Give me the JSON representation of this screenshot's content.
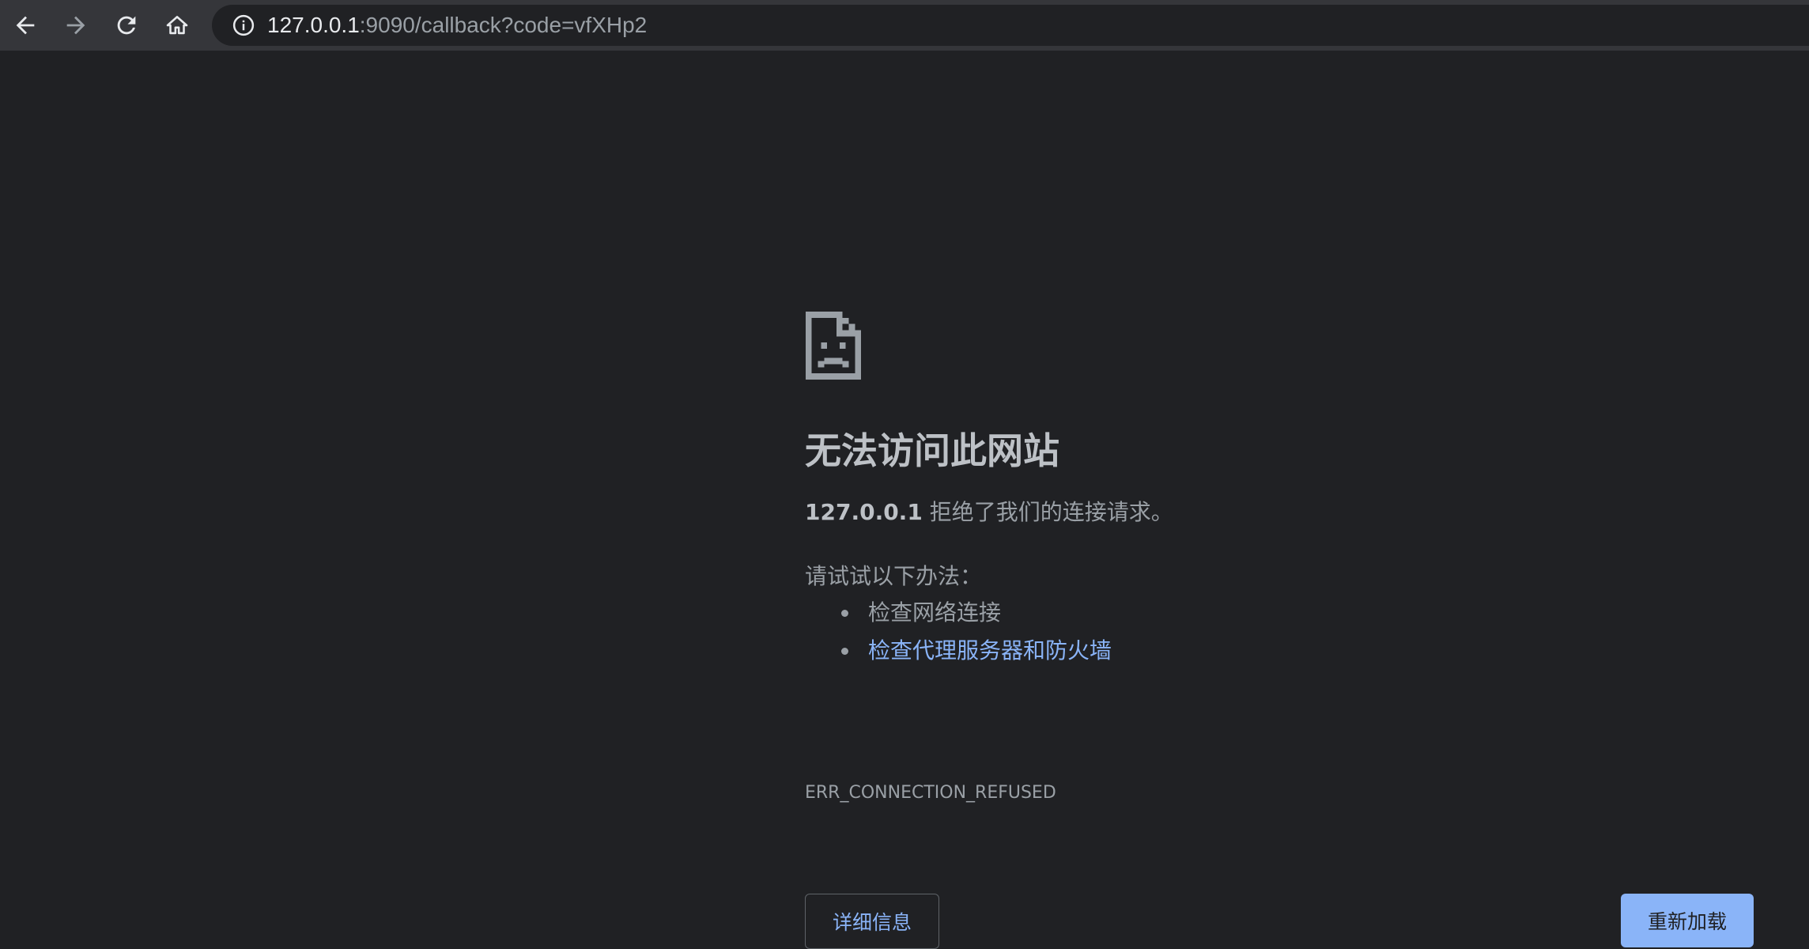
{
  "toolbar": {
    "icons": {
      "back": "arrow-left-icon",
      "forward": "arrow-right-icon",
      "reload": "reload-icon",
      "home": "home-icon",
      "site_info": "info-icon"
    },
    "url_host": "127.0.0.1",
    "url_rest": ":9090/callback?code=vfXHp2"
  },
  "error": {
    "icon": "sad-document-icon",
    "title": "无法访问此网站",
    "host": "127.0.0.1",
    "summary_rest": " 拒绝了我们的连接请求。",
    "suggestions_intro": "请试试以下办法：",
    "suggestions": [
      "检查网络连接",
      "检查代理服务器和防火墙"
    ],
    "code": "ERR_CONNECTION_REFUSED"
  },
  "buttons": {
    "details": "详细信息",
    "reload": "重新加载"
  },
  "colors": {
    "background": "#202124",
    "toolbar": "#35363a",
    "link": "#8ab4f8",
    "text": "#9aa0a6"
  }
}
